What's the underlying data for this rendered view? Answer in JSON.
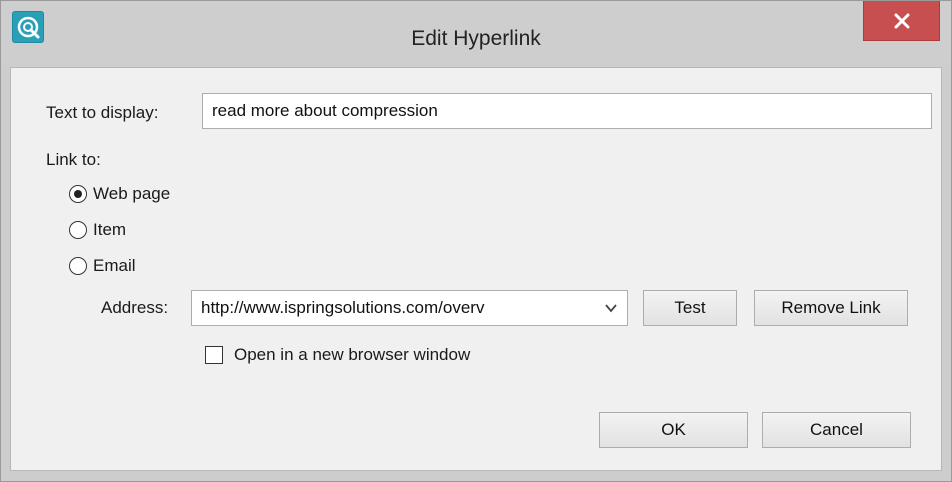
{
  "window": {
    "title": "Edit Hyperlink",
    "app_icon": "ispring-icon",
    "close_icon": "close-icon"
  },
  "form": {
    "text_to_display_label": "Text to display:",
    "text_to_display_value": "read more about compression",
    "link_to_label": "Link to:",
    "link_options": [
      {
        "label": "Web page",
        "selected": true
      },
      {
        "label": "Item",
        "selected": false
      },
      {
        "label": "Email",
        "selected": false
      }
    ],
    "address_label": "Address:",
    "address_value": "http://www.ispringsolutions.com/overv",
    "test_label": "Test",
    "remove_link_label": "Remove Link",
    "open_new_window_label": "Open in a new browser window",
    "open_new_window_checked": false
  },
  "footer": {
    "ok_label": "OK",
    "cancel_label": "Cancel"
  },
  "colors": {
    "close_button": "#c74f4f",
    "app_icon": "#2aa0b8",
    "dialog_background": "#f0f0f0"
  }
}
